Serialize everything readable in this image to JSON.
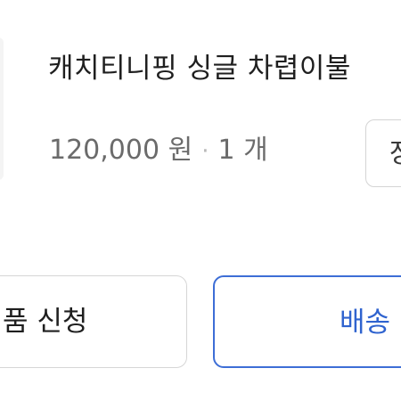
{
  "order_item": {
    "product_name": "캐치티니핑 싱글 차렵이불",
    "price": "120,000 원",
    "separator": "·",
    "quantity": "1 개",
    "side_action_label": "장"
  },
  "actions": {
    "left_button_label": "품 신청",
    "right_button_label": "배송"
  },
  "colors": {
    "primary_accent": "#2f63cf",
    "text_primary": "#1f1f1f",
    "text_secondary": "#6b6b6b",
    "border": "#d6d6d6"
  }
}
